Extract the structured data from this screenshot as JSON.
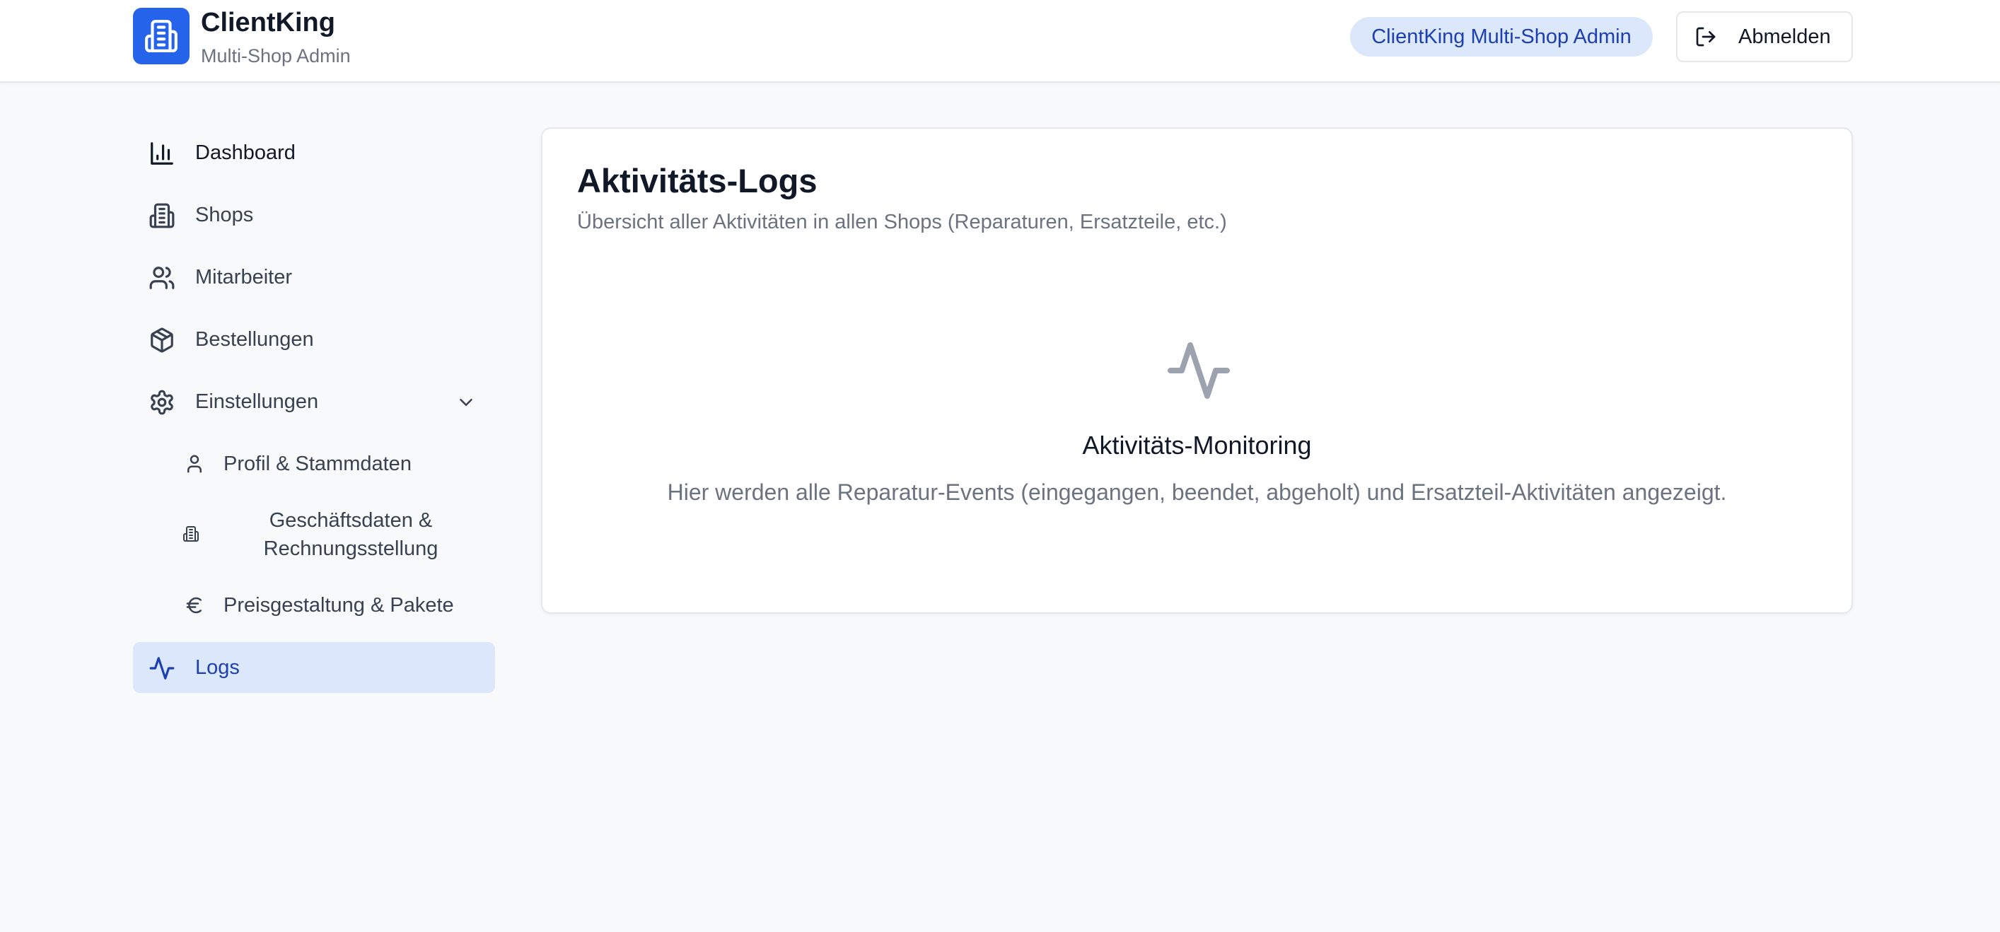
{
  "header": {
    "brand_title": "ClientKing",
    "brand_subtitle": "Multi-Shop Admin",
    "badge": "ClientKing Multi-Shop Admin",
    "logout_label": "Abmelden",
    "logo_icon": "building-icon",
    "accent_color": "#2563eb"
  },
  "sidebar": {
    "items": [
      {
        "label": "Dashboard",
        "icon": "bar-chart-icon"
      },
      {
        "label": "Shops",
        "icon": "building-icon"
      },
      {
        "label": "Mitarbeiter",
        "icon": "users-icon"
      },
      {
        "label": "Bestellungen",
        "icon": "package-icon"
      },
      {
        "label": "Einstellungen",
        "icon": "gear-icon",
        "expanded": true
      },
      {
        "label": "Logs",
        "icon": "activity-icon",
        "active": true
      }
    ],
    "settings_sub": [
      {
        "label": "Profil & Stammdaten",
        "icon": "user-icon"
      },
      {
        "label": "Geschäftsdaten & Rechnungsstellung",
        "icon": "building-icon"
      },
      {
        "label": "Preisgestaltung & Pakete",
        "icon": "euro-icon"
      }
    ],
    "active_color": "#dbe7fb"
  },
  "main": {
    "title": "Aktivitäts-Logs",
    "subtitle": "Übersicht aller Aktivitäten in allen Shops (Reparaturen, Ersatzteile, etc.)",
    "empty_state": {
      "icon": "activity-icon",
      "title": "Aktivitäts-Monitoring",
      "description": "Hier werden alle Reparatur-Events (eingegangen, beendet, abgeholt) und Ersatzteil-Aktivitäten angezeigt."
    }
  }
}
